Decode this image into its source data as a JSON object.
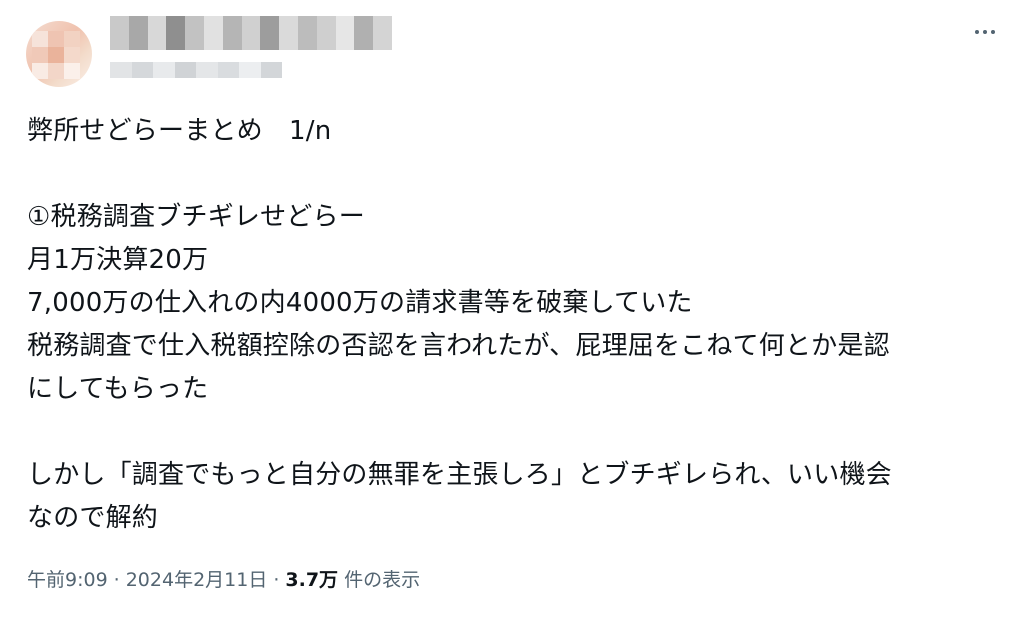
{
  "post": {
    "body_lines": [
      "弊所せどらーまとめ　1/n",
      "",
      "①税務調査ブチギレせどらー",
      "月1万決算20万",
      "7,000万の仕入れの内4000万の請求書等を破棄していた",
      "税務調査で仕入税額控除の否認を言われたが、屁理屈をこねて何とか是認",
      "にしてもらった",
      "",
      "しかし「調査でもっと自分の無罪を主張しろ」とブチギレられ、いい機会",
      "なので解約"
    ],
    "timestamp": "午前9:09",
    "date": "2024年2月11日",
    "separator": "·",
    "views_count": "3.7万",
    "views_label": "件の表示"
  },
  "icons": {
    "more": "more-horizontal-icon"
  },
  "colors": {
    "text_primary": "#0f1419",
    "text_secondary": "#536471",
    "background": "#ffffff"
  }
}
